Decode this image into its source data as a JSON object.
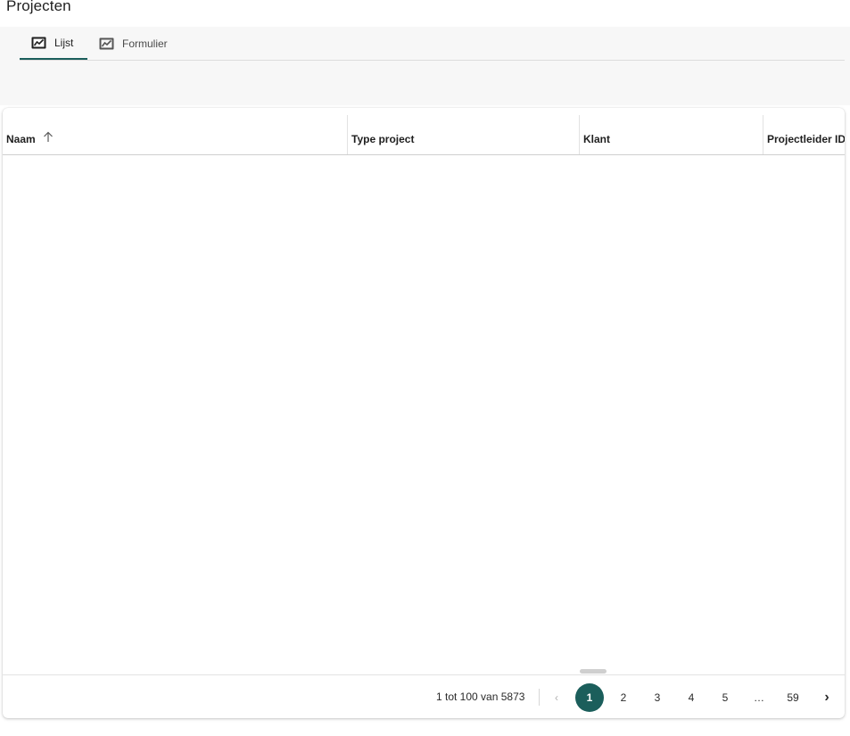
{
  "page": {
    "title": "Projecten"
  },
  "tabs": [
    {
      "label": "Lijst",
      "icon": "chart-icon",
      "active": true
    },
    {
      "label": "Formulier",
      "icon": "chart-icon",
      "active": false
    }
  ],
  "grid": {
    "columns": [
      {
        "label": "Naam",
        "sorted": "ascending"
      },
      {
        "label": "Type project"
      },
      {
        "label": "Klant"
      },
      {
        "label": "Projectleider ID"
      }
    ],
    "rows": []
  },
  "pagination": {
    "range_text": "1 tot 100 van 5873",
    "prev_symbol": "‹",
    "next_symbol": "›",
    "pages": [
      "1",
      "2",
      "3",
      "4",
      "5",
      "…",
      "59"
    ],
    "current_page": "1"
  },
  "colors": {
    "accent": "#1b5e5b",
    "toolbar_bg": "#f7f7f7"
  }
}
